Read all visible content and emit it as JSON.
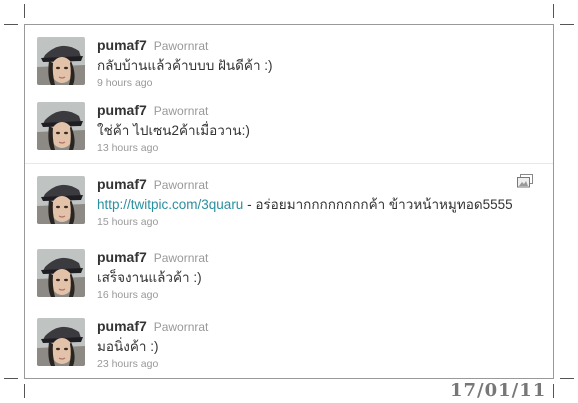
{
  "tweets": [
    {
      "username": "pumaf7",
      "realname": "Pawornrat",
      "text": "กลับบ้านแล้วค้าบบบ ฝันดีค้า :)",
      "time": "9 hours ago"
    },
    {
      "username": "pumaf7",
      "realname": "Pawornrat",
      "text": "ใช่ค้า ไปเซน2ค้าเมื่อวาน:)",
      "time": "13 hours ago"
    },
    {
      "username": "pumaf7",
      "realname": "Pawornrat",
      "link": "http://twitpic.com/3quaru",
      "text": " - อร่อยมากกกกกกกกค้า ข้าวหน้าหมูทอด5555",
      "time": "15 hours ago",
      "icon": "photo-media-icon"
    },
    {
      "username": "pumaf7",
      "realname": "Pawornrat",
      "text": "เสร็จงานแล้วค้า :)",
      "time": "16 hours ago"
    },
    {
      "username": "pumaf7",
      "realname": "Pawornrat",
      "text": "มอนิ่งค้า :)",
      "time": "23 hours ago"
    }
  ],
  "footer": {
    "date_stamp": "17/01/11"
  },
  "colors": {
    "link": "#2a8f9f",
    "text": "#333333",
    "meta": "#999999",
    "stamp": "#777777"
  }
}
